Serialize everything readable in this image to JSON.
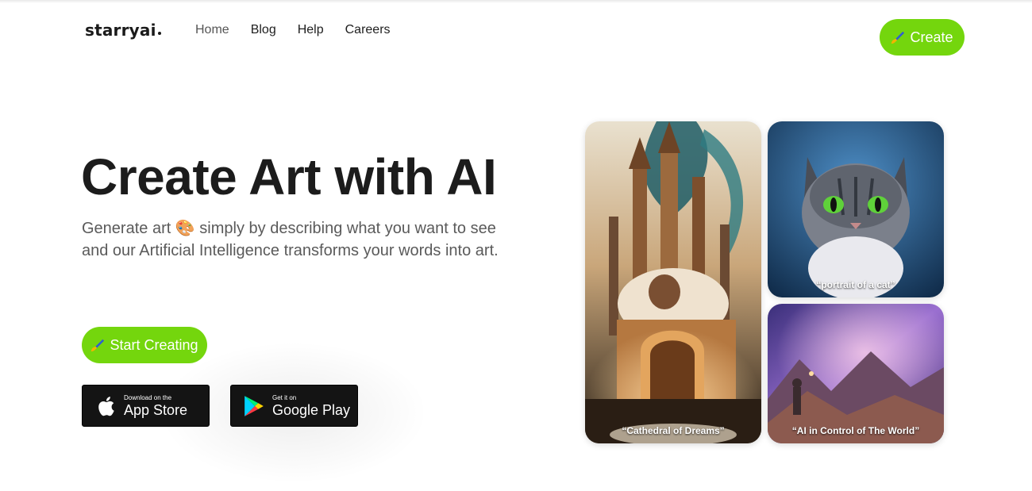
{
  "header": {
    "logo": "starryai",
    "nav": [
      {
        "label": "Home",
        "active": true
      },
      {
        "label": "Blog"
      },
      {
        "label": "Help"
      },
      {
        "label": "Careers"
      }
    ],
    "create_label": "Create"
  },
  "hero": {
    "title": "Create Art with AI",
    "subtitle_line1": "Generate art 🎨 simply by describing what you want to see",
    "subtitle_line2": "and our Artificial Intelligence transforms your words into art.",
    "start_label": "Start Creating"
  },
  "stores": {
    "app_store": {
      "small": "Download on the",
      "big": "App Store"
    },
    "google_play": {
      "small": "Get it on",
      "big": "Google Play"
    }
  },
  "gallery": [
    {
      "caption": "“Cathedral of Dreams”"
    },
    {
      "caption": "“portrait of a cat”"
    },
    {
      "caption": "“AI in Control of The World”"
    }
  ],
  "colors": {
    "accent": "#74d60d",
    "store_bg": "#141414"
  },
  "icons": {
    "brush": "paintbrush-icon",
    "apple": "apple-icon",
    "play": "google-play-icon"
  }
}
